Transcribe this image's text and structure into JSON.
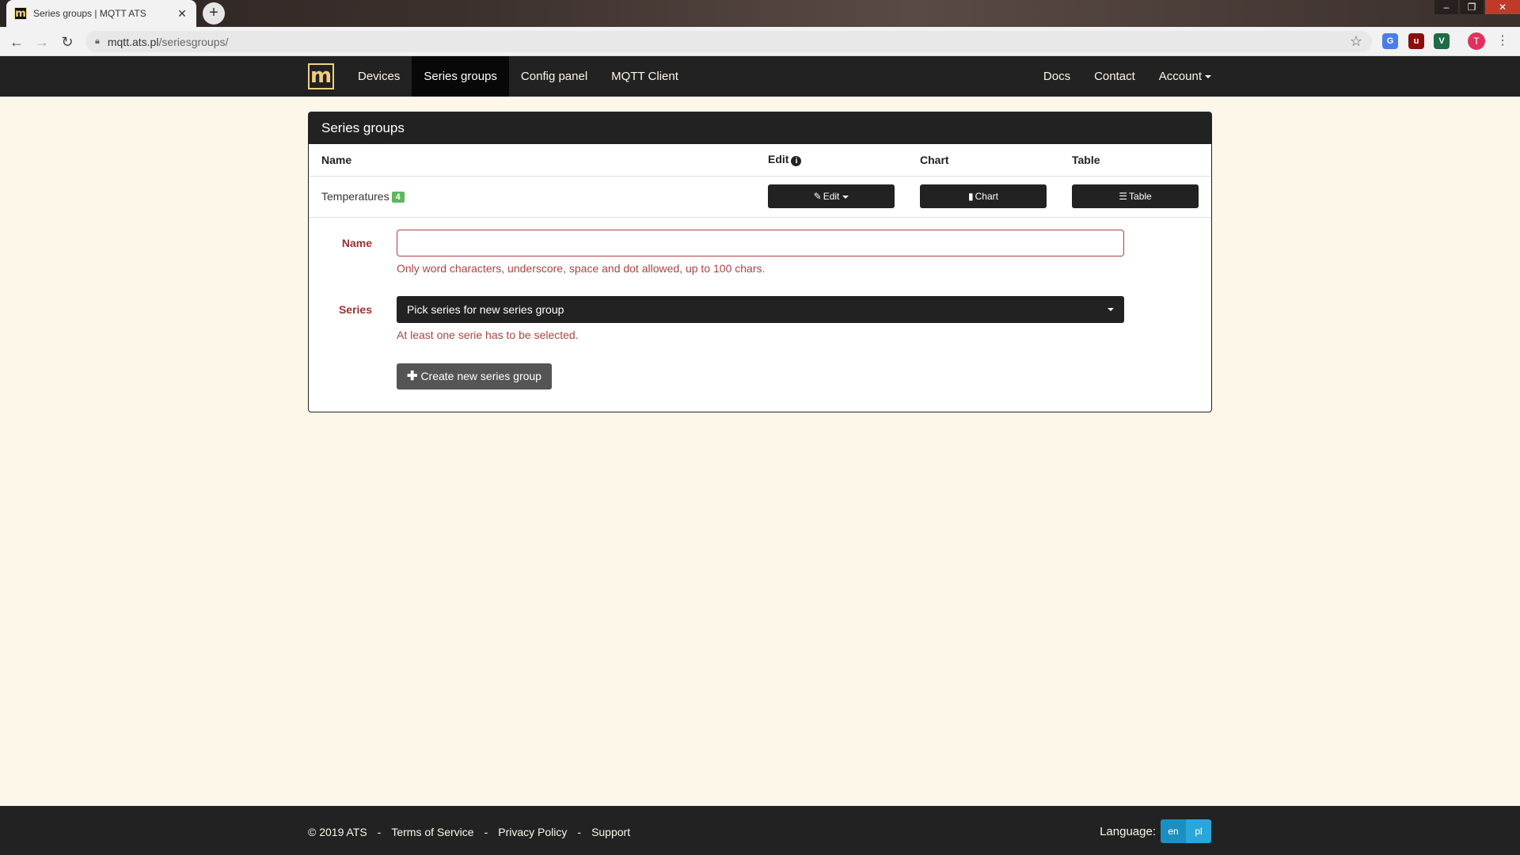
{
  "browser": {
    "tab_title": "Series groups | MQTT ATS",
    "tab_favicon": "m",
    "url_host": "mqtt.ats.pl",
    "url_path": "/seriesgroups/",
    "profile_initial": "T"
  },
  "navbar": {
    "brand": "m",
    "links": [
      "Devices",
      "Series groups",
      "Config panel",
      "MQTT Client"
    ],
    "active": "Series groups",
    "right_links": [
      "Docs",
      "Contact",
      "Account"
    ]
  },
  "panel": {
    "title": "Series groups",
    "columns": [
      "Name",
      "Edit",
      "Chart",
      "Table"
    ],
    "rows": [
      {
        "name": "Temperatures",
        "count": "4",
        "edit": "Edit",
        "chart": "Chart",
        "table": "Table"
      }
    ]
  },
  "form": {
    "name_label": "Name",
    "name_value": "",
    "name_help": "Only word characters, underscore, space and dot allowed, up to 100 chars.",
    "series_label": "Series",
    "series_placeholder": "Pick series for new series group",
    "series_help": "At least one serie has to be selected.",
    "create_button": "Create new series group"
  },
  "footer": {
    "copyright": "© 2019 ATS",
    "links": [
      "Terms of Service",
      "Privacy Policy",
      "Support"
    ],
    "language_label": "Language:",
    "languages": [
      "en",
      "pl"
    ],
    "active_language": "en"
  },
  "colors": {
    "page_background": "#fdf7ea",
    "navbar": "#222222",
    "brand_gold": "#f1cf7e",
    "error_red": "#a94442",
    "badge_green": "#5cb85c",
    "language_blue": "#2aa6db"
  }
}
